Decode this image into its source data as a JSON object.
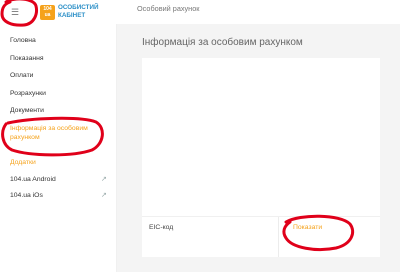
{
  "header": {
    "menu_icon": "hamburger-icon",
    "logo_badge": "104 ua",
    "logo_text_line1": "ОСОБИСТИЙ",
    "logo_text_line2": "КАБІНЕТ",
    "page_title": "Особовий рахунок"
  },
  "sidebar": {
    "items": [
      {
        "label": "Головна"
      },
      {
        "label": "Показання"
      },
      {
        "label": "Оплати"
      },
      {
        "label": "Розрахунки"
      },
      {
        "label": "Документи"
      },
      {
        "label": "Інформація за особовим рахунком"
      }
    ],
    "apps_heading": "Додатки",
    "app_links": [
      {
        "label": "104.ua Android",
        "icon": "external-link-icon"
      },
      {
        "label": "104.ua iOs",
        "icon": "external-link-icon"
      }
    ]
  },
  "main": {
    "title": "Інформація за особовим рахунком",
    "eic_label": "ЕІС-код",
    "show_button": "Показати"
  },
  "colors": {
    "accent": "#f5a21b",
    "logo_text": "#2b8fc7",
    "annotation_red": "#e0001a"
  }
}
